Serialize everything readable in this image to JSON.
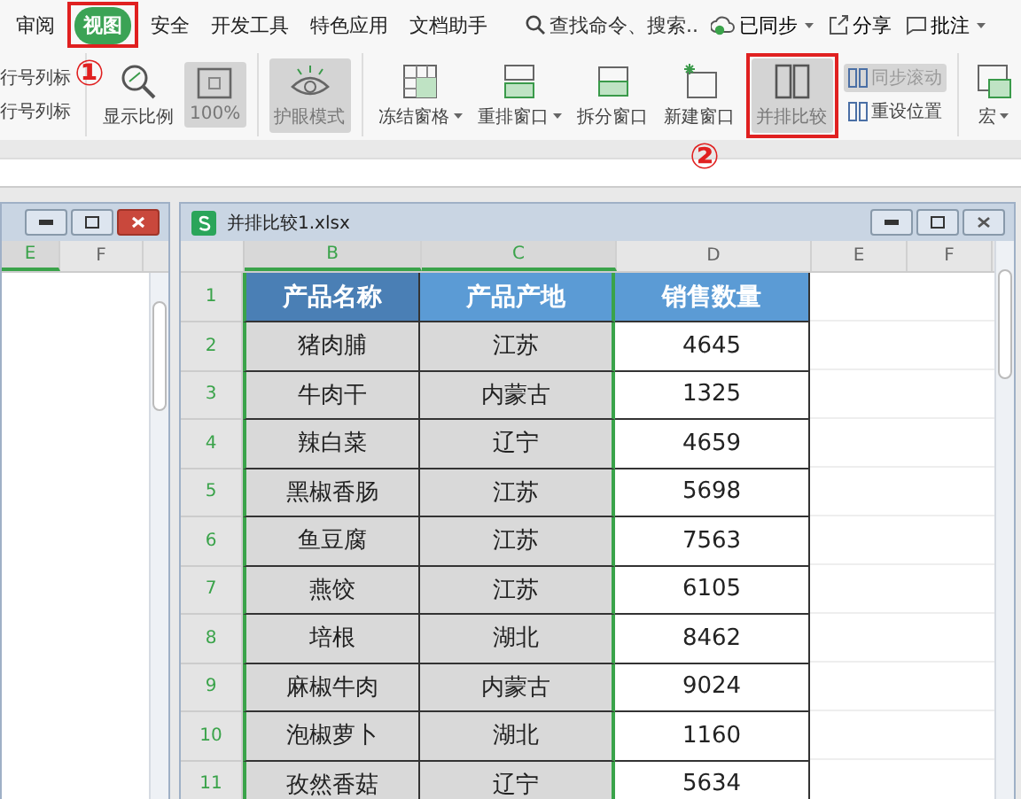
{
  "tabs": [
    {
      "label": "审阅",
      "selected": false
    },
    {
      "label": "视图",
      "selected": true,
      "highlighted": true
    },
    {
      "label": "安全",
      "selected": false
    },
    {
      "label": "开发工具",
      "selected": false
    },
    {
      "label": "特色应用",
      "selected": false
    },
    {
      "label": "文档助手",
      "selected": false
    }
  ],
  "search": {
    "placeholder": "查找命令、搜索..."
  },
  "top_actions": [
    {
      "label": "已同步",
      "dropdown": true
    },
    {
      "label": "分享"
    },
    {
      "label": "批注",
      "dropdown": true
    }
  ],
  "ribbon": [
    {
      "items": [
        {
          "kind": "stack",
          "items": [
            {
              "label": "行号列标",
              "disabled": false,
              "selected": false
            },
            {
              "label": "行号列标",
              "disabled": false,
              "selected": false
            }
          ]
        }
      ]
    },
    {
      "items": [
        {
          "kind": "large",
          "label": "显示比例",
          "selected": false
        },
        {
          "kind": "large",
          "label": "100%",
          "selected": true
        }
      ]
    },
    {
      "items": [
        {
          "kind": "large",
          "label": "护眼模式",
          "selected": true
        }
      ]
    },
    {
      "items": [
        {
          "kind": "large",
          "label": "冻结窗格",
          "selected": false,
          "dropdown": true
        },
        {
          "kind": "large",
          "label": "重排窗口",
          "selected": false,
          "dropdown": true
        },
        {
          "kind": "large",
          "label": "拆分窗口",
          "selected": false
        },
        {
          "kind": "large",
          "label": "新建窗口",
          "selected": false
        },
        {
          "kind": "large",
          "label": "并排比较",
          "selected": true,
          "highlighted": true
        },
        {
          "kind": "stack",
          "items": [
            {
              "label": "同步滚动",
              "disabled": true,
              "selected": true
            },
            {
              "label": "重设位置",
              "disabled": false,
              "selected": false
            }
          ]
        }
      ]
    },
    {
      "items": [
        {
          "kind": "large",
          "label": "宏",
          "selected": false,
          "dropdown": true
        }
      ]
    }
  ],
  "annotations": [
    {
      "text": "①"
    },
    {
      "text": "②"
    }
  ],
  "left_window": {
    "columns": [
      {
        "label": "E",
        "selected": true
      },
      {
        "label": "F",
        "selected": false
      }
    ]
  },
  "right_window": {
    "title": "并排比较1.xlsx",
    "columns": [
      {
        "label": "B",
        "selected": true
      },
      {
        "label": "C",
        "selected": true
      },
      {
        "label": "D",
        "selected": false
      },
      {
        "label": "E",
        "selected": false
      },
      {
        "label": "F",
        "selected": false
      }
    ],
    "rows": [
      {
        "number": "1",
        "kind": "header",
        "selected": true,
        "cells": [
          "产品名称",
          "产品产地",
          "销售数量"
        ]
      },
      {
        "number": "2",
        "kind": "data",
        "selected": true,
        "cells": [
          "猪肉脯",
          "江苏",
          "4645"
        ]
      },
      {
        "number": "3",
        "kind": "data",
        "selected": true,
        "cells": [
          "牛肉干",
          "内蒙古",
          "1325"
        ]
      },
      {
        "number": "4",
        "kind": "data",
        "selected": true,
        "cells": [
          "辣白菜",
          "辽宁",
          "4659"
        ]
      },
      {
        "number": "5",
        "kind": "data",
        "selected": true,
        "cells": [
          "黑椒香肠",
          "江苏",
          "5698"
        ]
      },
      {
        "number": "6",
        "kind": "data",
        "selected": true,
        "cells": [
          "鱼豆腐",
          "江苏",
          "7563"
        ]
      },
      {
        "number": "7",
        "kind": "data",
        "selected": true,
        "cells": [
          "燕饺",
          "江苏",
          "6105"
        ]
      },
      {
        "number": "8",
        "kind": "data",
        "selected": true,
        "cells": [
          "培根",
          "湖北",
          "8462"
        ]
      },
      {
        "number": "9",
        "kind": "data",
        "selected": true,
        "cells": [
          "麻椒牛肉",
          "内蒙古",
          "9024"
        ]
      },
      {
        "number": "10",
        "kind": "data",
        "selected": true,
        "cells": [
          "泡椒萝卜",
          "湖北",
          "1160"
        ]
      },
      {
        "number": "11",
        "kind": "data",
        "selected": true,
        "cells": [
          "孜然香菇",
          "辽宁",
          "5634"
        ]
      }
    ]
  }
}
